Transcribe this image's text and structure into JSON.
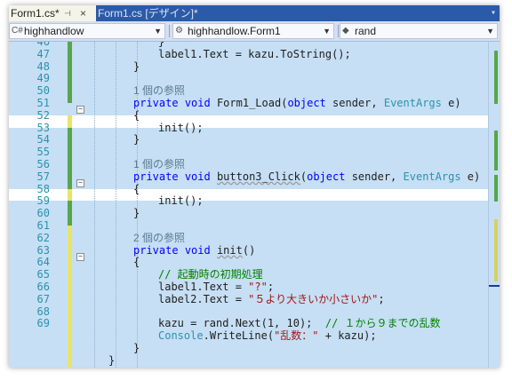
{
  "tabs": {
    "active_label": "Form1.cs*",
    "pin_glyph": "⊣",
    "close_glyph": "×",
    "inactive_label": "Form1.cs [デザイン]*",
    "menu_glyph": "▾"
  },
  "navbar": {
    "project": "highhandlow",
    "class_scope": "highhandlow.Form1",
    "member": "rand"
  },
  "editor": {
    "line_numbers": [
      "46",
      "47",
      "48",
      "49",
      "50",
      "51",
      "52",
      "53",
      "54",
      "55",
      "56",
      "57",
      "58",
      "59",
      "60",
      "61",
      "62",
      "63",
      "64",
      "65",
      "66",
      "67",
      "68",
      "69"
    ],
    "ref_3_1": "1 個の参照",
    "ref_4_1": "1 個の参照",
    "ref_6_1": "2 個の参照",
    "t_brace": "}",
    "t_open_brace": "{",
    "l47_a": "label1.Text = kazu.",
    "l47_b": "ToString",
    "l47_c": "();",
    "kw_private": "private",
    "kw_void": "void",
    "kw_object": "object",
    "ty_eventargs": "EventArgs",
    "l50_name": "Form1_Load",
    "l55_name": "button3_Click",
    "l60_name": "init",
    "t_sender": "sender,",
    "t_e": "e)",
    "t_open_paren": "(",
    "t_parens": "()",
    "t_init_call": "init();",
    "l62_comment": "// 起動時の初期処理",
    "l63_a": "label1.Text = ",
    "l63_str": "\"?\"",
    "l64_a": "label2.Text = ",
    "l64_str": "\"５より大きいか小さいか\"",
    "l66_a": "kazu = rand.",
    "l66_b": "Next",
    "l66_c": "(1, 10);",
    "l66_comment": "// １から９までの乱数",
    "l67_ty": "Console",
    "l67_b": ".",
    "l67_c": "WriteLine",
    "l67_d": "(",
    "l67_str": "\"乱数：\"",
    "l67_e": " + kazu);",
    "semi": ";"
  }
}
